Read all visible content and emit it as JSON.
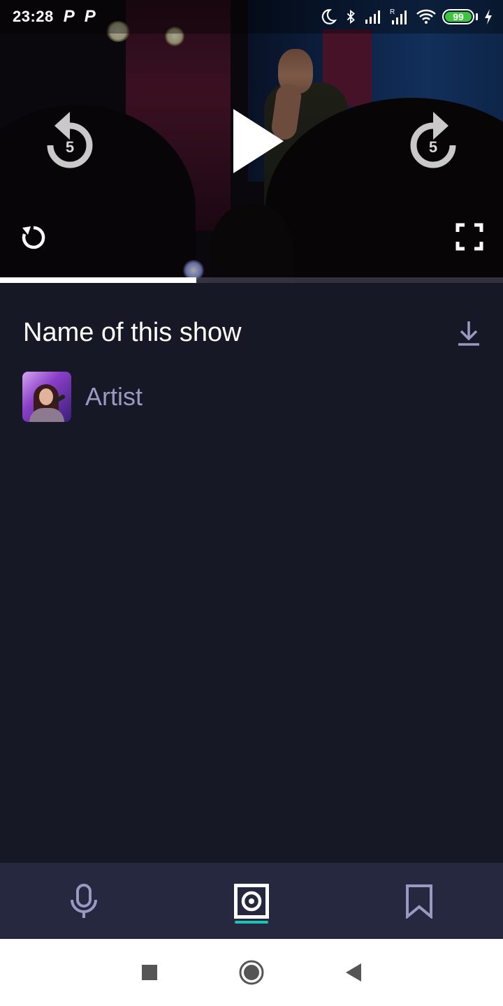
{
  "status_bar": {
    "time": "23:28",
    "notifications": [
      "P",
      "P"
    ],
    "battery_level": "99",
    "battery_percent": 0.99,
    "icons": [
      "moon-icon",
      "bluetooth-icon",
      "signal-icon",
      "signal-roaming-icon",
      "wifi-icon",
      "battery-icon",
      "charging-icon"
    ]
  },
  "player": {
    "skip_back_seconds": "5",
    "skip_forward_seconds": "5",
    "progress_fraction": 0.39,
    "icons": {
      "skip_back": "skip-back-icon",
      "play": "play-icon",
      "skip_forward": "skip-forward-icon",
      "replay": "replay-icon",
      "fullscreen": "fullscreen-icon"
    }
  },
  "show": {
    "title": "Name of this show",
    "artist": "Artist",
    "download_icon": "download-icon"
  },
  "bottom_nav": {
    "items": [
      {
        "icon": "microphone-icon",
        "active": false
      },
      {
        "icon": "speaker-icon",
        "active": true
      },
      {
        "icon": "bookmark-icon",
        "active": false
      }
    ],
    "accent_color": "#1fc3b4"
  },
  "system_nav": {
    "icons": [
      "recents-square-icon",
      "home-circle-icon",
      "back-triangle-icon"
    ]
  },
  "colors": {
    "background": "#171826",
    "nav_background": "#262840",
    "artist_text": "#9a99c2",
    "icon_muted": "#9a99c2"
  }
}
